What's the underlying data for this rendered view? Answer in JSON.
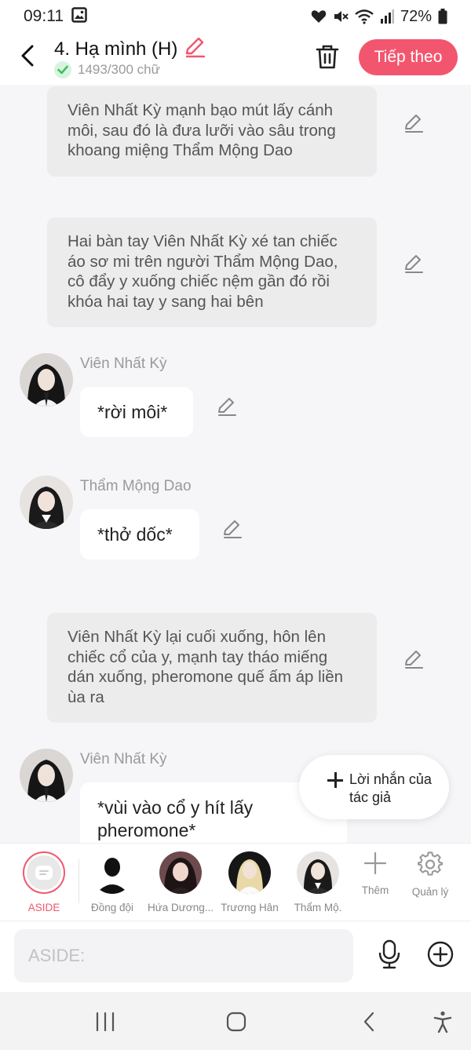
{
  "status_bar": {
    "time": "09:11",
    "battery": "72%"
  },
  "header": {
    "title": "4. Hạ mình (H)",
    "word_count": "1493/300 chữ",
    "next_label": "Tiếp theo"
  },
  "chat": {
    "narration_1": "Viên Nhất Kỳ mạnh bạo mút lấy cánh môi, sau đó là đưa lưỡi vào sâu trong khoang miệng Thẩm Mộng Dao",
    "narration_2": "Hai bàn tay Viên Nhất Kỳ xé tan chiếc áo sơ mi trên người Thẩm Mộng Dao, cô đẩy y xuống chiếc nệm gần đó rồi khóa hai tay y sang hai bên",
    "msg_1": {
      "name": "Viên Nhất Kỳ",
      "text": "*rời môi*"
    },
    "msg_2": {
      "name": "Thẩm Mộng Dao",
      "text": "*thở dốc*"
    },
    "narration_3": "Viên Nhất Kỳ lại cuối xuống, hôn lên chiếc cổ của y, mạnh tay tháo miếng dán xuống, pheromone quế ấm áp liền ùa ra",
    "msg_3": {
      "name": "Viên Nhất Kỳ",
      "text": "*vùi vào cổ y hít lấy pheromone*"
    },
    "author_note_label": "Lời nhắn của tác giả"
  },
  "char_bar": {
    "items": [
      {
        "label": "ASIDE"
      },
      {
        "label": "Đồng đội"
      },
      {
        "label": "Hứa Dương..."
      },
      {
        "label": "Trương Hân"
      },
      {
        "label": "Thẩm Mộ."
      }
    ],
    "add_label": "Thêm",
    "manage_label": "Quản lý"
  },
  "input": {
    "placeholder": "ASIDE:"
  },
  "colors": {
    "accent": "#f2566e",
    "check": "#3cc05c"
  }
}
